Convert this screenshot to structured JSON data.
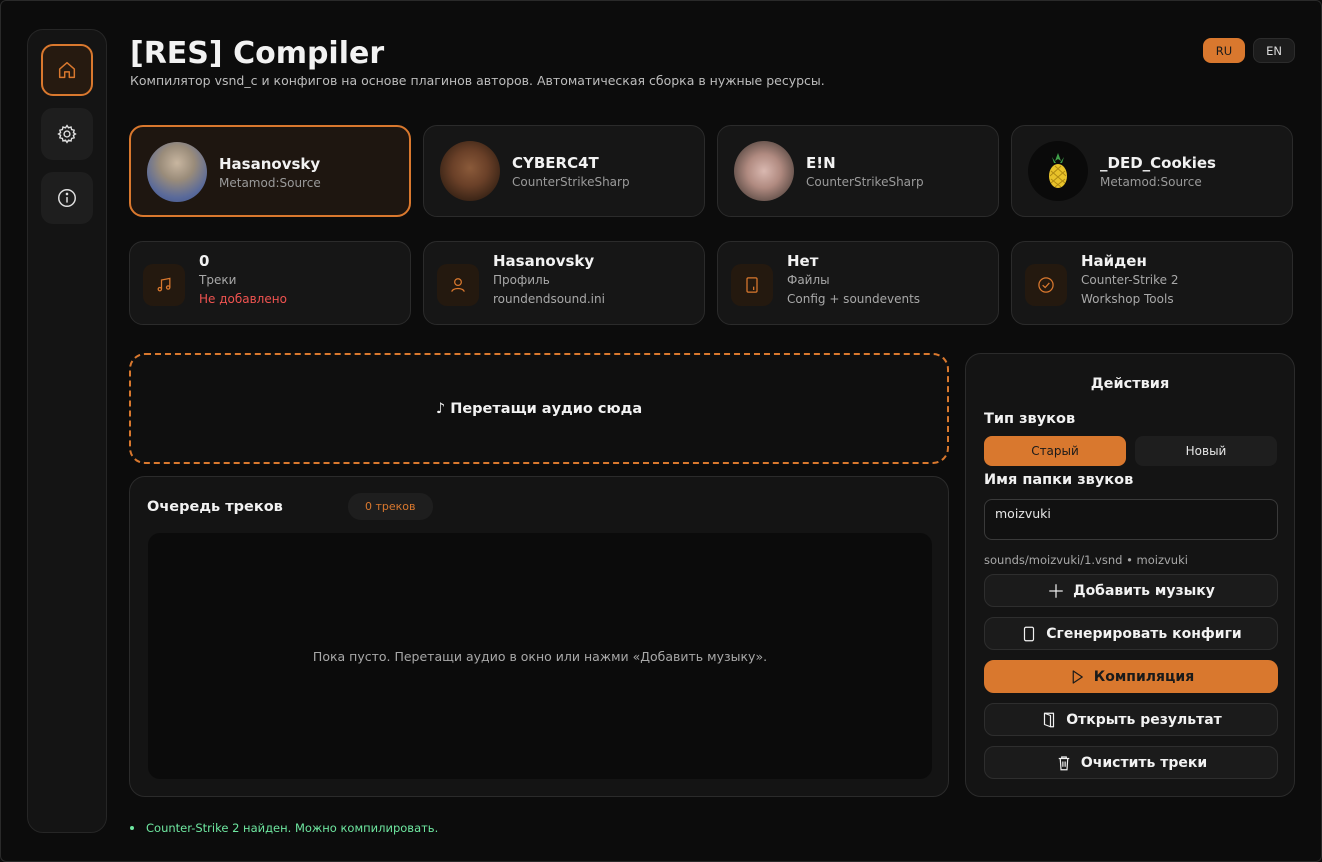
{
  "app": {
    "title": "[RES] Compiler",
    "subtitle": "Компилятор vsnd_c и конфигов на основе плагинов авторов. Автоматическая сборка в нужные ресурсы."
  },
  "lang": {
    "ru": "RU",
    "en": "EN",
    "active": "RU"
  },
  "sidebar": {
    "items": [
      {
        "icon": "home-icon",
        "active": true
      },
      {
        "icon": "gear-icon",
        "active": false
      },
      {
        "icon": "info-icon",
        "active": false
      }
    ]
  },
  "authors": [
    {
      "name": "Hasanovsky",
      "platform": "Metamod:Source",
      "selected": true
    },
    {
      "name": "CYBERC4T",
      "platform": "CounterStrikeSharp",
      "selected": false
    },
    {
      "name": "E!N",
      "platform": "CounterStrikeSharp",
      "selected": false
    },
    {
      "name": "_DED_Cookies",
      "platform": "Metamod:Source",
      "selected": false
    }
  ],
  "info": [
    {
      "icon": "music-note-icon",
      "value": "0",
      "label": "Треки",
      "detail": "Не добавлено"
    },
    {
      "icon": "user-icon",
      "value": "Hasanovsky",
      "label": "Профиль",
      "detail": "roundendsound.ini"
    },
    {
      "icon": "file-icon",
      "value": "Нет",
      "label": "Файлы",
      "detail": "Config + soundevents"
    },
    {
      "icon": "check-circle-icon",
      "value": "Найден",
      "label": "Counter-Strike 2",
      "detail": "Workshop Tools"
    }
  ],
  "dropzone": {
    "text": "♪  Перетащи аудио сюда"
  },
  "queue": {
    "title": "Очередь треков",
    "count_badge": "0 треков",
    "empty_text": "Пока пусто. Перетащи аудио в окно или нажми «Добавить музыку»."
  },
  "actions": {
    "title": "Действия",
    "sound_type_label": "Тип звуков",
    "sound_type_old": "Старый",
    "sound_type_new": "Новый",
    "sound_type_selected": "Старый",
    "folder_label": "Имя папки звуков",
    "folder_value": "moizvuki",
    "path_preview": "sounds/moizvuki/1.vsnd  •  moizvuki",
    "add_music": "Добавить музыку",
    "generate_configs": "Сгенерировать конфиги",
    "compile": "Компиляция",
    "open_result": "Открыть результат",
    "clear_tracks": "Очистить треки"
  },
  "status": {
    "text": "Counter-Strike 2 найден. Можно компилировать.",
    "color": "#6ee7a0"
  },
  "colors": {
    "accent": "#d9782e",
    "background": "#0c0c0c",
    "panel": "#141414",
    "error": "#ef5350"
  }
}
